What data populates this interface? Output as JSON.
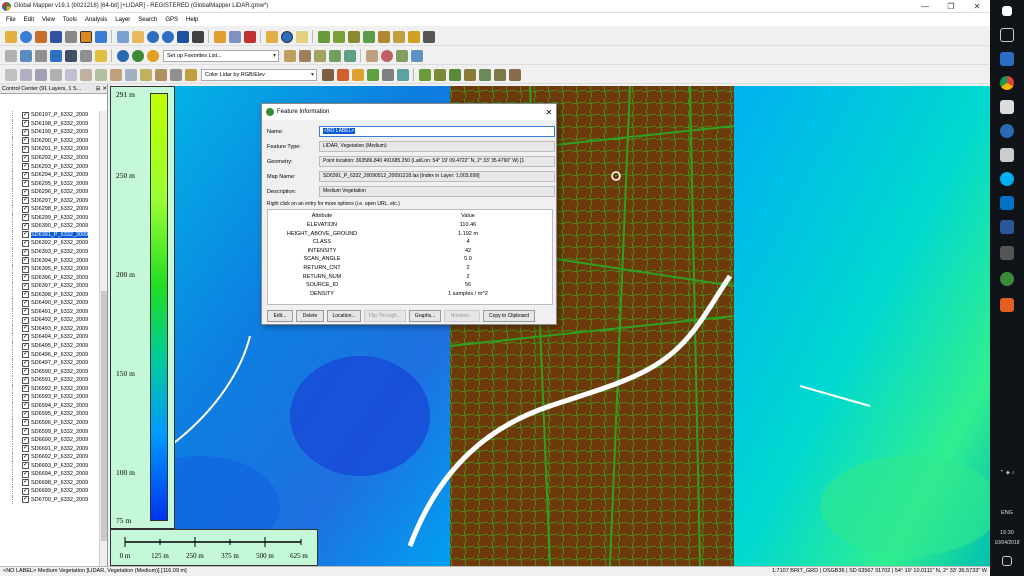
{
  "window": {
    "title": "Global Mapper v19.1 (b021218) [64-bit] [+LIDAR] - REGISTERED (GlobalMapper LiDAR.gmw*)"
  },
  "menu": [
    "File",
    "Edit",
    "View",
    "Tools",
    "Analysis",
    "Layer",
    "Search",
    "GPS",
    "Help"
  ],
  "toolbar": {
    "favorites_combo": "Set up Favorites List...",
    "shader_combo": "Color Lidar by RGB/Elev"
  },
  "control_center": {
    "title": "Control Center (91 Layers, 1 S...",
    "layers": [
      "SD6197_P_6332_2009",
      "SD6198_P_6332_2009",
      "SD6199_P_6332_2009",
      "SD6290_P_6332_2009",
      "SD6291_P_6332_2009",
      "SD6292_P_6332_2009",
      "SD6293_P_6332_2009",
      "SD6294_P_6332_2009",
      "SD6295_P_6332_2009",
      "SD6296_P_6332_2009",
      "SD6297_P_6332_2009",
      "SD6298_P_6332_2009",
      "SD6299_P_6332_2009",
      "SD6390_P_6332_2009",
      "SD6391_P_6332_2009",
      "SD6392_P_6332_2009",
      "SD6393_P_6332_2009",
      "SD6394_P_6332_2009",
      "SD6395_P_6332_2009",
      "SD6396_P_6332_2009",
      "SD6397_P_6332_2009",
      "SD6398_P_6332_2009",
      "SD6490_P_6332_2009",
      "SD6491_P_6332_2009",
      "SD6492_P_6332_2009",
      "SD6493_P_6332_2009",
      "SD6494_P_6332_2009",
      "SD6495_P_6332_2009",
      "SD6496_P_6332_2009",
      "SD6497_P_6332_2009",
      "SD6590_P_6332_2009",
      "SD6591_P_6332_2009",
      "SD6592_P_6332_2009",
      "SD6593_P_6332_2009",
      "SD6594_P_6332_2009",
      "SD6595_P_6332_2009",
      "SD6596_P_6332_2009",
      "SD6599_P_6332_2009",
      "SD6690_P_6332_2009",
      "SD6691_P_6332_2009",
      "SD6692_P_6332_2009",
      "SD6693_P_6332_2009",
      "SD6694_P_6332_2009",
      "SD6698_P_6332_2009",
      "SD6699_P_6332_2009",
      "SD6700_P_6332_2009"
    ],
    "selected_index": 14
  },
  "legend": {
    "labels": [
      "291 m",
      "250 m",
      "200 m",
      "150 m",
      "100 m",
      "75 m"
    ]
  },
  "scalebar": {
    "labels": [
      "0 m",
      "125 m",
      "250 m",
      "375 m",
      "500 m",
      "625 m"
    ]
  },
  "dialog": {
    "title": "Feature Information",
    "name_label": "Name:",
    "name_value": "<NO LABEL>",
    "type_label": "Feature Type:",
    "type_value": "LIDAR, Vegetation (Medium)",
    "geom_label": "Geometry:",
    "geom_value": "Point location: 363586.840 491685.250 (Lat/Lon: 54° 19' 09.4722\" N, 2° 33' 35.4790\" W) [1",
    "map_label": "Map Name:",
    "map_value": "SD6391_P_6332_20090512_20091218.las [Index in Layer: 1,003,699]",
    "desc_label": "Description:",
    "desc_value": "Medium Vegetation",
    "hint": "Right click on an entry for more options (i.e. open URL, etc.)",
    "col_attr": "Attribute",
    "col_value": "Value",
    "attributes": [
      [
        "ELEVATION",
        "110.46"
      ],
      [
        "HEIGHT_ABOVE_GROUND",
        "1.192 m"
      ],
      [
        "CLASS",
        "4"
      ],
      [
        "INTENSITY",
        "42"
      ],
      [
        "SCAN_ANGLE",
        "5.0"
      ],
      [
        "RETURN_CNT",
        "2"
      ],
      [
        "RETURN_NUM",
        "2"
      ],
      [
        "SOURCE_ID",
        "56"
      ],
      [
        "DENSITY",
        "1 samples / m^2"
      ]
    ],
    "buttons": [
      "Edit...",
      "Delete",
      "Location...",
      "Flip-Through...",
      "Graphs...",
      "Notation...",
      "Copy to Clipboard"
    ]
  },
  "status": {
    "left": "<NO LABEL> Medium Vegetation [LIDAR, Vegetation (Medium)] [116.09 m]",
    "right": "1:7107  BRIT_GRD | OSGB36 | SD 63567 91702 | 54° 19' 10.0111\" N, 2° 33' 36.5733\" W"
  },
  "clock": {
    "time": "16:30",
    "date": "10/04/2018",
    "lang": "ENG"
  }
}
